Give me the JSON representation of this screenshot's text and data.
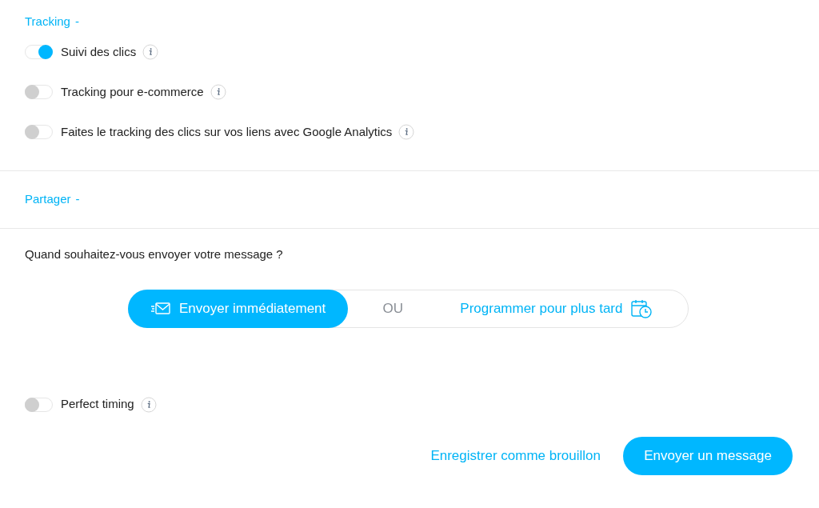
{
  "tracking": {
    "title": "Tracking",
    "toggle_sign": "-",
    "options": [
      {
        "label": "Suivi des clics",
        "on": true
      },
      {
        "label": "Tracking pour e-commerce",
        "on": false
      },
      {
        "label": "Faites le tracking des clics sur vos liens avec Google Analytics",
        "on": false
      }
    ]
  },
  "share": {
    "title": "Partager",
    "toggle_sign": "-"
  },
  "schedule": {
    "question": "Quand souhaitez-vous envoyer votre message ?",
    "separator": "OU",
    "choices": [
      {
        "label": "Envoyer immédiatement",
        "kind": "now",
        "selected": true
      },
      {
        "label": "Programmer pour plus tard",
        "kind": "later",
        "selected": false
      }
    ]
  },
  "perfect_timing": {
    "label": "Perfect timing",
    "on": false
  },
  "actions": {
    "draft": "Enregistrer comme brouillon",
    "send": "Envoyer un message"
  }
}
